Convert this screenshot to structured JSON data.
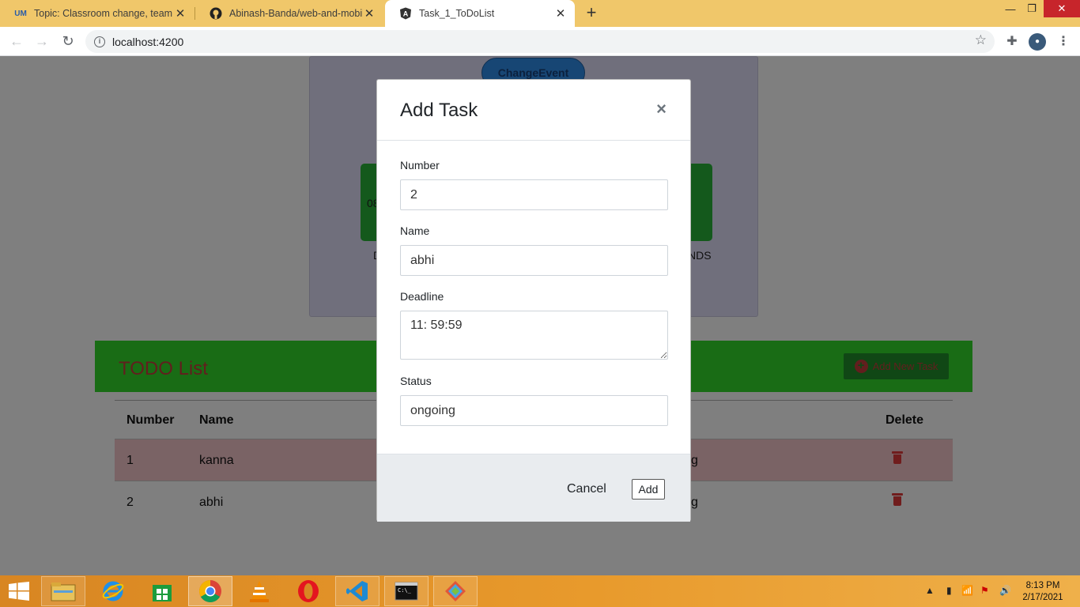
{
  "browser": {
    "tabs": [
      {
        "title": "Topic: Classroom change, team in",
        "favicon": "umkc-logo-icon",
        "active": false
      },
      {
        "title": "Abinash-Banda/web-and-mobile",
        "favicon": "github-icon",
        "active": false
      },
      {
        "title": "Task_1_ToDoList",
        "favicon": "angular-icon",
        "active": true
      }
    ],
    "address": "localhost:4200"
  },
  "page": {
    "change_event_label": "ChangeEvent",
    "left_fragment_a": "08",
    "left_fragment_b": "D",
    "right_fragment": "NDS",
    "todo_title": "TODO List",
    "add_new_task_label": "Add New Task",
    "table": {
      "headers": {
        "number": "Number",
        "name": "Name",
        "delete": "Delete"
      },
      "rows": [
        {
          "number": "1",
          "name": "kanna",
          "status_fragment": "g"
        },
        {
          "number": "2",
          "name": "abhi",
          "status_fragment": "g"
        }
      ]
    }
  },
  "modal": {
    "title": "Add Task",
    "close": "×",
    "fields": {
      "number": {
        "label": "Number",
        "value": "2"
      },
      "name": {
        "label": "Name",
        "value": "abhi"
      },
      "deadline": {
        "label": "Deadline",
        "value": "11: 59:59"
      },
      "status": {
        "label": "Status",
        "value": "ongoing"
      }
    },
    "cancel_label": "Cancel",
    "add_label": "Add"
  },
  "taskbar": {
    "time": "8:13 PM",
    "date": "2/17/2021"
  },
  "colors": {
    "tab_strip": "#f0c76a",
    "todo_header": "#33d92b",
    "danger_row": "#f5c6cb",
    "trash": "#e03b3b",
    "taskbar": "#e89a2c"
  }
}
